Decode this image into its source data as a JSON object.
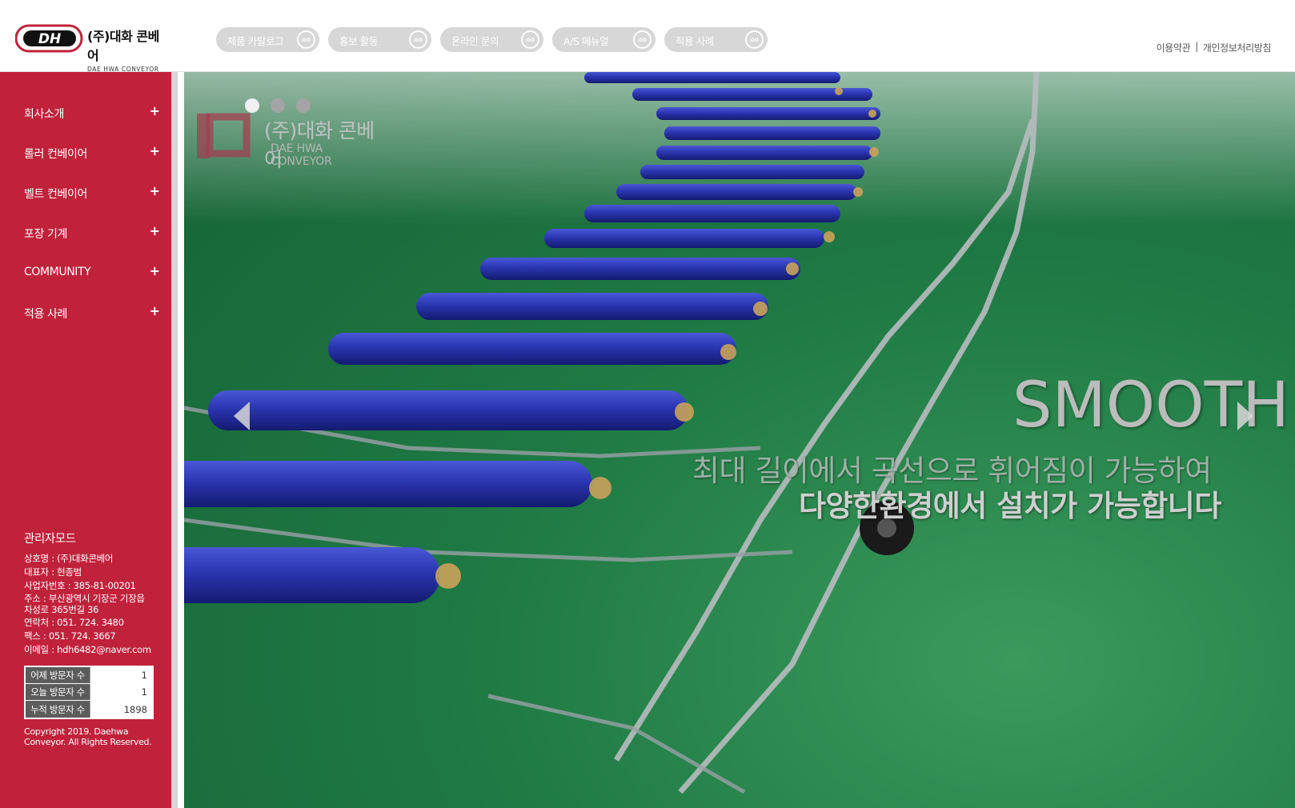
{
  "brand": {
    "logo_initials": "DH",
    "name": "(주)대화 콘베어",
    "sub": "DAE HWA CONVEYOR",
    "color": "#c0223b"
  },
  "top_nav": [
    {
      "label": "제품 카탈로그",
      "go": "GO"
    },
    {
      "label": "홍보 활동",
      "go": "GO"
    },
    {
      "label": "온라인 문의",
      "go": "GO"
    },
    {
      "label": "A/S 메뉴얼",
      "go": "GO"
    },
    {
      "label": "적용 사례",
      "go": "GO"
    }
  ],
  "util_links": {
    "terms": "이용약관",
    "separator": "|",
    "privacy": "개인정보처리방침"
  },
  "sidebar": {
    "menu": [
      {
        "label": "회사소개",
        "icon": "plus-icon",
        "expander": "+"
      },
      {
        "label": "롤러 컨베이어",
        "icon": "plus-icon",
        "expander": "+"
      },
      {
        "label": "벨트 컨베이어",
        "icon": "plus-icon",
        "expander": "+"
      },
      {
        "label": "포장 기계",
        "icon": "plus-icon",
        "expander": "+"
      },
      {
        "label": "COMMUNITY",
        "icon": "plus-icon",
        "expander": "+"
      },
      {
        "label": "적용 사례",
        "icon": "plus-icon",
        "expander": "+"
      }
    ],
    "admin_mode": "관리자모드",
    "company_info": [
      "상호명 : (주)대화콘베어",
      "대표자 : 현종범",
      "사업자번호 : 385-81-00201",
      "주소 : 부산광역시 기장군 기장읍",
      "차성로 365번길 36",
      "연락처 : 051. 724. 3480",
      "팩스 : 051. 724. 3667",
      "이메일 : hdh6482@naver.com"
    ],
    "visitors": [
      {
        "label": "어제 방문자 수",
        "value": "1"
      },
      {
        "label": "오늘 방문자 수",
        "value": "1"
      },
      {
        "label": "누적 방문자 수",
        "value": "1898"
      }
    ],
    "copyright": "Copyright 2019. Daehwa Conveyor. All Rights Reserved."
  },
  "hero": {
    "slide_count": 3,
    "active_slide": 1,
    "watermark_name": "(주)대화 콘베어",
    "watermark_sub": "DAE HWA CONVEYOR",
    "headline": "SMOOTH",
    "caption_line1": "최대 길이에서 곡선으로 휘어짐이 가능하여",
    "caption_line2": "다양한환경에서 설치가 가능합니다",
    "prev_icon": "chevron-left-icon",
    "next_icon": "chevron-right-icon",
    "colors": {
      "roller": "#2a35b0",
      "floor": "#1f7a44",
      "frame": "#b8bcc0"
    }
  }
}
